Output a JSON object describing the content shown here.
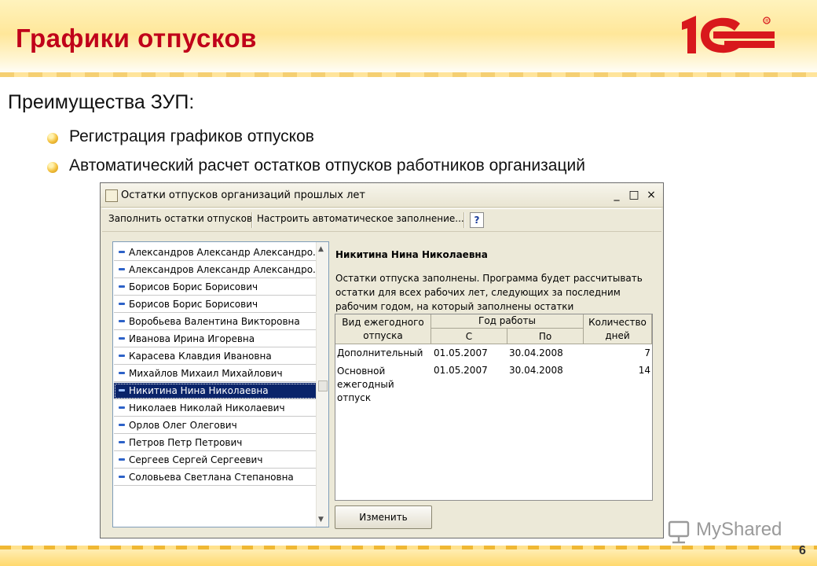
{
  "slide": {
    "title": "Графики отпусков",
    "page_number": "6",
    "watermark": "MyShared",
    "logo_text": "1С"
  },
  "content": {
    "heading": "Преимущества ЗУП:",
    "bullets": [
      "Регистрация графиков отпусков",
      "Автоматический расчет остатков отпусков работников организаций"
    ]
  },
  "window": {
    "title": "Остатки отпусков организаций прошлых лет",
    "controls": {
      "minimize": "_",
      "maximize": "□",
      "close": "×"
    },
    "toolbar": {
      "fill_button": "Заполнить остатки отпусков",
      "auto_fill_button": "Настроить автоматическое заполнение...",
      "help_button": "?"
    },
    "employees": [
      "Александров Александр Александро...",
      "Александров Александр Александро...",
      "Борисов Борис Борисович",
      "Борисов Борис Борисович",
      "Воробьева Валентина Викторовна",
      "Иванова Ирина Игоревна",
      "Карасева Клавдия Ивановна",
      "Михайлов Михаил Михайлович",
      "Никитина Нина  Николаевна",
      "Николаев Николай Николаевич",
      "Орлов  Олег  Олегович",
      "Петров Петр Петрович",
      "Сергеев Сергей Сергеевич",
      "Соловьева Светлана Степановна"
    ],
    "selected_index": 8,
    "selected_employee": "Никитина Нина  Николаевна",
    "info_text": "Остатки отпуска заполнены. Программа будет рассчитывать остатки для всех рабочих лет, следующих за последним рабочим годом, на который заполнены остатки",
    "grid": {
      "headers": {
        "vacation_type": "Вид ежегодного отпуска",
        "work_year": "Год работы",
        "from": "С",
        "to": "По",
        "days": "Количество дней"
      },
      "rows": [
        {
          "type": "Дополнительный",
          "from": "01.05.2007",
          "to": "30.04.2008",
          "days": "7"
        },
        {
          "type": "Основной ежегодный отпуск",
          "from": "01.05.2007",
          "to": "30.04.2008",
          "days": "14"
        }
      ]
    },
    "edit_button": "Изменить"
  }
}
